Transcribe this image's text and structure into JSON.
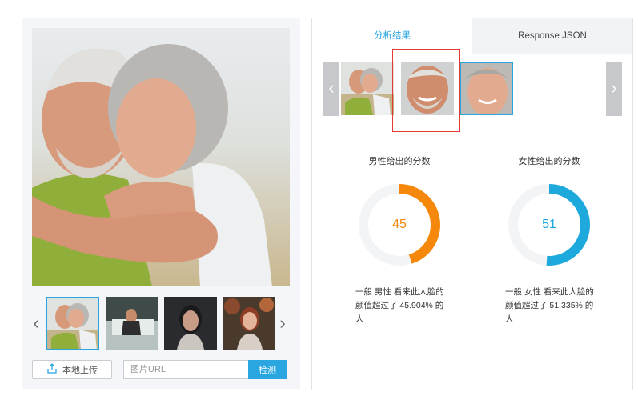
{
  "left": {
    "upload_label": "本地上传",
    "url_placeholder": "图片URL",
    "detect_label": "检测",
    "prev_arrow": "‹",
    "next_arrow": "›"
  },
  "tabs": [
    {
      "label": "分析结果",
      "active": true
    },
    {
      "label": "Response JSON",
      "active": false
    }
  ],
  "faces": {
    "prev_arrow": "‹",
    "next_arrow": "›"
  },
  "male_score": {
    "title": "男性给出的分数",
    "value": "45",
    "percent": 45,
    "color": "#f5880a",
    "desc": "一般 男性 看来此人脸的颜值超过了 45.904% 的人"
  },
  "female_score": {
    "title": "女性给出的分数",
    "value": "51",
    "percent": 51,
    "color": "#1ea9dd",
    "desc": "一般 女性 看来此人脸的颜值超过了 51.335% 的人"
  },
  "colors": {
    "accent": "#29a5e0",
    "highlight": "#e53935"
  }
}
